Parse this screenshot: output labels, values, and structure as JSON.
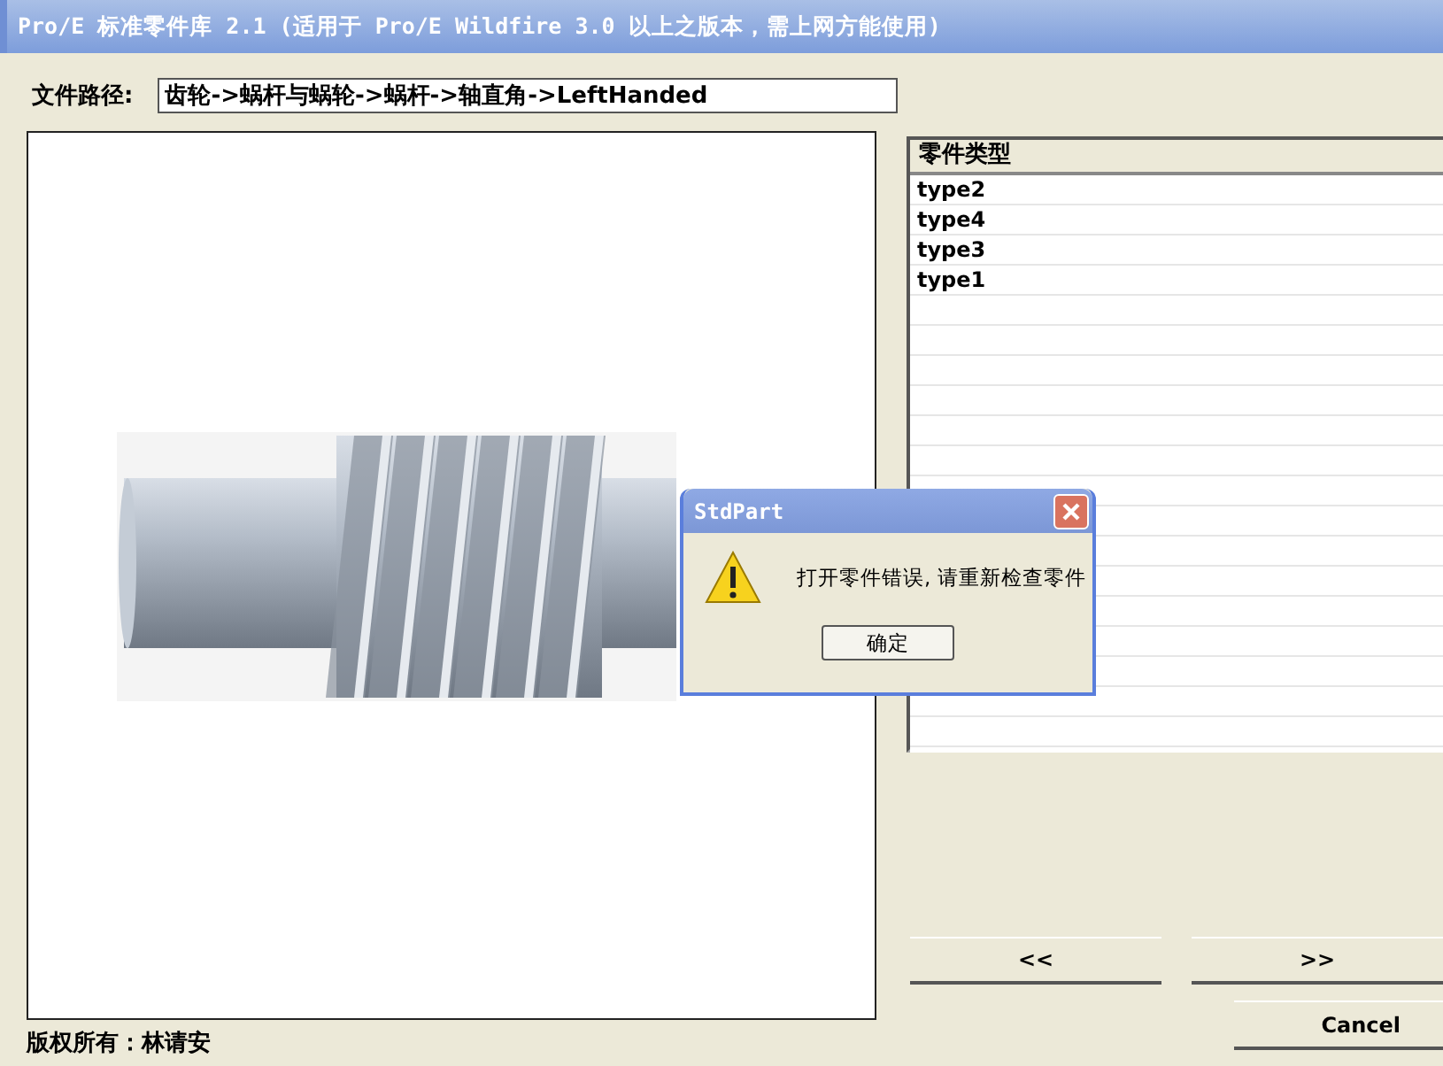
{
  "window": {
    "title": "Pro/E 标准零件库 2.1 (适用于 Pro/E Wildfire 3.0 以上之版本，需上网方能使用)"
  },
  "path": {
    "label": "文件路径:",
    "value": "齿轮->蜗杆与蜗轮->蜗杆->轴直角->LeftHanded"
  },
  "part_types": {
    "header": "零件类型",
    "items": [
      "type2",
      "type4",
      "type3",
      "type1"
    ]
  },
  "buttons": {
    "prev": "<<",
    "next": ">>",
    "cancel": "Cancel"
  },
  "footer": "版权所有：林请安",
  "dialog": {
    "title": "StdPart",
    "message": "打开零件错误, 请重新检查零件",
    "button": "确定"
  }
}
